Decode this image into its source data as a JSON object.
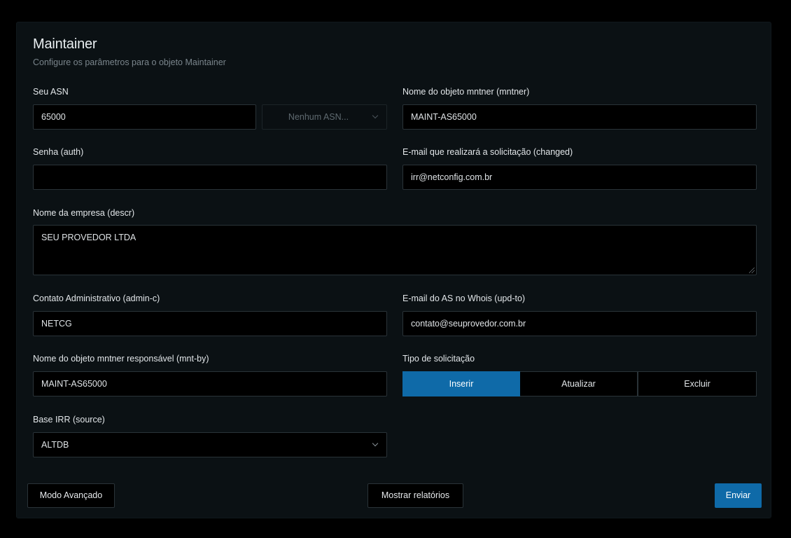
{
  "header": {
    "title": "Maintainer",
    "subtitle": "Configure os parâmetros para o objeto Maintainer"
  },
  "form": {
    "asn": {
      "label": "Seu ASN",
      "value": "65000"
    },
    "asn_select": {
      "value": "Nenhum ASN..."
    },
    "mntner": {
      "label": "Nome do objeto mntner (mntner)",
      "value": "MAINT-AS65000"
    },
    "auth": {
      "label": "Senha (auth)",
      "value": ""
    },
    "changed": {
      "label": "E-mail que realizará a solicitação (changed)",
      "value": "irr@netconfig.com.br"
    },
    "descr": {
      "label": "Nome da empresa (descr)",
      "value": "SEU PROVEDOR LTDA"
    },
    "admin_c": {
      "label": "Contato Administrativo (admin-c)",
      "value": "NETCG"
    },
    "upd_to": {
      "label": "E-mail do AS no Whois (upd-to)",
      "value": "contato@seuprovedor.com.br"
    },
    "mnt_by": {
      "label": "Nome do objeto mntner responsável (mnt-by)",
      "value": "MAINT-AS65000"
    },
    "request_type": {
      "label": "Tipo de solicitação",
      "options": [
        "Inserir",
        "Atualizar",
        "Excluir"
      ],
      "selected": "Inserir"
    },
    "source": {
      "label": "Base IRR (source)",
      "value": "ALTDB"
    }
  },
  "footer": {
    "advanced_label": "Modo Avançado",
    "reports_label": "Mostrar relatórios",
    "submit_label": "Enviar"
  },
  "colors": {
    "accent": "#0f6aa8",
    "background": "#000000",
    "card": "#0b1114"
  }
}
